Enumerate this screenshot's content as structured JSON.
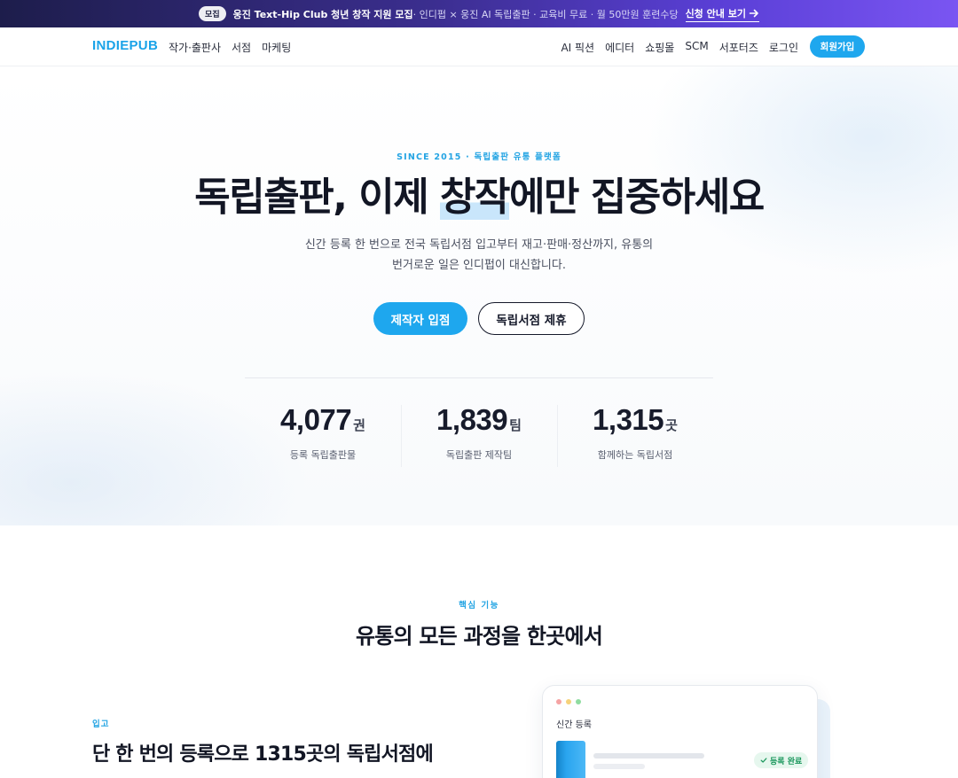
{
  "announcement": {
    "badge": "모집",
    "headline": "웅진 Text-Hip Club 청년 창작 지원 모집",
    "details": "· 인디펍 × 웅진 AI 독립출판 · 교육비 무료 · 월 50만원 훈련수당",
    "cta": "신청 안내 보기",
    "cta_icon": "arrow-right-icon"
  },
  "nav": {
    "logo": "INDIEPUB",
    "left_links": [
      "작가·출판사",
      "서점",
      "마케팅"
    ],
    "right_links": [
      "AI 픽션",
      "에디터",
      "쇼핑몰",
      "SCM",
      "서포터즈",
      "로그인"
    ],
    "signup": "회원가입"
  },
  "hero": {
    "eyebrow": "SINCE 2015 · 독립출판 유통 플랫폼",
    "headline_before": "독립출판, 이제 ",
    "headline_highlight": "창작",
    "headline_after": "에만 집중하세요",
    "subcopy_line1": "신간 등록 한 번으로 전국 독립서점 입고부터 재고·판매·정산까지, 유통의",
    "subcopy_line2": "번거로운 일은 인디펍이 대신합니다.",
    "primary_button": "제작자 입점",
    "secondary_button": "독립서점 제휴",
    "stats": [
      {
        "value": "4,077",
        "unit": "권",
        "label": "등록 독립출판물"
      },
      {
        "value": "1,839",
        "unit": "팀",
        "label": "독립출판 제작팀"
      },
      {
        "value": "1,315",
        "unit": "곳",
        "label": "함께하는 독립서점"
      }
    ]
  },
  "features": {
    "eyebrow": "핵심 기능",
    "title": "유통의 모든 과정을 한곳에서",
    "tag": "입고",
    "heading": "단 한 번의 등록으로 1315곳의 독립서점에",
    "mock": {
      "title": "신간 등록",
      "status": "등록 완료",
      "status_icon": "check-icon",
      "dot_colors": [
        "#f5a3a3",
        "#f6d27a",
        "#8fdca0"
      ]
    }
  },
  "colors": {
    "accent": "#1ea7ee",
    "dark_text": "#121624",
    "announce_gradient_start": "#1d1d4b",
    "announce_gradient_end": "#7a55f2"
  }
}
